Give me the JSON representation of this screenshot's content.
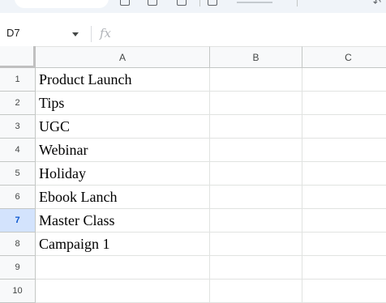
{
  "formula_bar": {
    "name_box": "D7",
    "fx_icon": "fx-icon",
    "formula_value": ""
  },
  "grid": {
    "columns": [
      "A",
      "B",
      "C"
    ],
    "rows": [
      {
        "num": "1",
        "a": "Product Launch",
        "b": "",
        "c": ""
      },
      {
        "num": "2",
        "a": "Tips",
        "b": "",
        "c": ""
      },
      {
        "num": "3",
        "a": "UGC",
        "b": "",
        "c": ""
      },
      {
        "num": "4",
        "a": "Webinar",
        "b": "",
        "c": ""
      },
      {
        "num": "5",
        "a": "Holiday",
        "b": "",
        "c": ""
      },
      {
        "num": "6",
        "a": "Ebook Lanch",
        "b": "",
        "c": ""
      },
      {
        "num": "7",
        "a": "Master Class",
        "b": "",
        "c": ""
      },
      {
        "num": "8",
        "a": "Campaign 1",
        "b": "",
        "c": ""
      },
      {
        "num": "9",
        "a": "",
        "b": "",
        "c": ""
      },
      {
        "num": "10",
        "a": "",
        "b": "",
        "c": ""
      }
    ],
    "active_row": "7",
    "selection_color": "#d3e3fd"
  },
  "colors": {
    "toolbar_bg": "#f0f4f9",
    "header_bg": "#f8f9fa",
    "active_header": "#0b57d0"
  }
}
